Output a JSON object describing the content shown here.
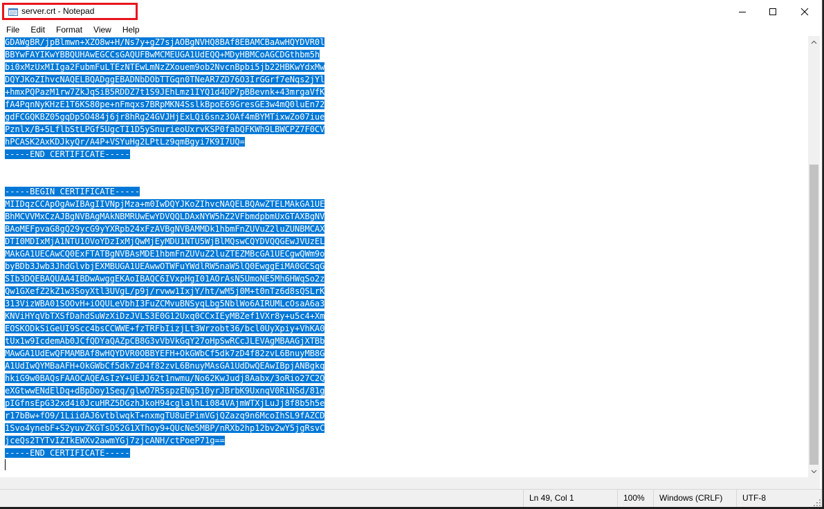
{
  "window": {
    "title": "server.crt - Notepad",
    "minimize_label": "Minimize",
    "maximize_label": "Maximize",
    "close_label": "Close"
  },
  "menu": [
    {
      "label": "File"
    },
    {
      "label": "Edit"
    },
    {
      "label": "Format"
    },
    {
      "label": "View"
    },
    {
      "label": "Help"
    }
  ],
  "editor": {
    "lines": [
      "GDAWgBR/jpBlmwn+XZO8w+H/Ns7y+gZ7sjAOBgNVHQ8BAf8EBAMCBaAwHQYDVR0l",
      "BBYwFAYIKwYBBQUHAwEGCCsGAQUFBwMCMEUGA1UdEQQ+MDyHBMCoAGCDGthbm5h",
      "bi0xMzUxMIIga2FubmFuLTEzNTEwLmNzZXouem9ob2NvcnBpbi5jb22HBKwYdxMw",
      "DQYJKoZIhvcNAQELBQADggEBADNbDObTTGqn0TNeAR7ZD76O3IrGGrf7eNqs2jYl",
      "+hmxPQPazM1rw7ZkJqSiB5RDDZ7t1S9JEhLmz1IYQ1d4DP7pBBevnk+43mrgaVfK",
      "fA4PqnNyKHzE1T6KS80pe+nFmqxs7BRpMKN4SslkBpoE69GresGE3w4mQ0luEn72",
      "gdFCGQKBZ05gqDp5O484j6jr8hRg24GVJHjExLQi6snz3OAf4mBYMTixwZo07iue",
      "Pznlx/B+5LflbStLPGf5UgcTI1D5ySnurieoUxrvKSP0fabQFKWh9LBWCPZ7F0CV",
      "hPCASK2AxKDJkyQr/A4P+VSYuHg2LPtLz9qmBgyi7K9I7UQ=",
      "-----END CERTIFICATE-----",
      "",
      "",
      "-----BEGIN CERTIFICATE-----",
      "MIIDqzCCApOgAwIBAgIIVNpjMza+m0IwDQYJKoZIhvcNAQELBQAwZTELMAkGA1UE",
      "BhMCVVMxCzAJBgNVBAgMAkNBMRUwEwYDVQQLDAxNYW5hZ2VFbmdpbmUxGTAXBgNV",
      "BAoMEFpvaG8gQ29ycG9yYXRpb24xFzAVBgNVBAMMDk1hbmFnZUVuZ2luZUNBMCAX",
      "DTI0MDIxMjA1NTU1OVoYDzIxMjQwMjEyMDU1NTU5WjBlMQswCQYDVQQGEwJVUzEL",
      "MAkGA1UECAwCQ0ExFTATBgNVBAsMDE1hbmFnZUVuZ2luZTEZMBcGA1UECgwQWm9o",
      "byBDb3Jwb3JhdGlvbjEXMBUGA1UEAwwOTWFuYWdlRW5naW5lQ0EwggEiMA0GCSqG",
      "SIb3DQEBAQUAA4IBDwAwggEKAoIBAQC6IVxpHgI01AOrAsN5UmoNE5Mh6HWqSo2z",
      "Qw1GXefZ2kZ1w3SoyXtl3UVgL/p9j/rvww1IxjY/ht/wM5j0M+t0nTz6d8sQSLrK",
      "313VizWBA01SOOvH+iOQULeVbhI3FuZCMvuBNSyqLbg5NblWo6AIRUMLcOsaA6a3",
      "KNViHYqVbTXSfDahdSuWzXiDzJVLS3E0G12Uxq0CCxIEyMBZef1VXr8y+u5c4+Xm",
      "EOSKODkSiGeUI9Scc4bsCCWWE+fzTRFbIizjLt3Wrzobt36/bcl0UyXpiy+VhKA0",
      "tUx1w9IcdemAb0JCfQDYaQAZpCB8G3vVbVkGqY27oHpSwRCcJLEVAgMBAAGjXTBb",
      "MAwGA1UdEwQFMAMBAf8wHQYDVR0OBBYEFH+OkGWbCf5dk7zD4f82zvL6BnuyMB8G",
      "A1UdIwQYMBaAFH+OkGWbCf5dk7zD4f82zvL6BnuyMAsGA1UdDwQEAwIBpjANBgkq",
      "hkiG9w0BAQsFAAOCAQEAsIzY+UEJJ62t1nwmu/No62KwJudj8Aabx/3oRio27C2Q",
      "eXGtwwENdElDq+dBpDoy1Seq/glwO7R5spzENg510yrJBrbK9UxnqV0RiNSd/81g",
      "pIGfnsEpG32xd4i0JcuHRZ5DGzhJkoH94cglalhLi084VAjmWTXjLuJj8f8b5h5e",
      "r17bBw+fO9/1LiidAJ6vtblwqkT+nxmgTU8uEPimVGjQZazq9n6McoIhSL9fAZCD",
      "1Svo4ynebF+S2yuvZKGTsD52G1XThoy9+QUcNe5MBP/nRXb2hp12bv2wY5jgRsvC",
      "jceQs2TYTvIZTkEWXv2awmYGj7zjcANH/ctPoeP71g==",
      "-----END CERTIFICATE-----",
      ""
    ]
  },
  "status": {
    "position": "Ln 49, Col 1",
    "zoom": "100%",
    "line_ending": "Windows (CRLF)",
    "encoding": "UTF-8"
  },
  "colors": {
    "selection": "#0078d7",
    "title_highlight_border": "#e8141c"
  }
}
